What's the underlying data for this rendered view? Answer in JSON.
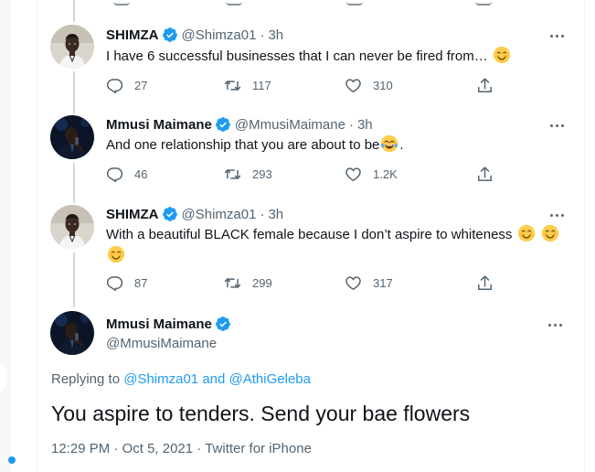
{
  "colors": {
    "accent": "#1d9bf0",
    "text_primary": "#0f1419",
    "text_secondary": "#536471",
    "thread_line": "#cfd9de"
  },
  "tweets": [
    {
      "name": "SHIMZA",
      "handle": "@Shimza01",
      "separator": "·",
      "time": "3h",
      "text": "I have 6 successful businesses that I can never be fired from…",
      "emoji_after": [
        "smiling-face-emoji"
      ],
      "replies": "27",
      "retweets": "117",
      "likes": "310",
      "avatar_icon": "shimza-avatar"
    },
    {
      "name": "Mmusi Maimane",
      "handle": "@MmusiMaimane",
      "separator": "·",
      "time": "3h",
      "text": "And one relationship that you are about to be",
      "emoji_after": [
        "tears-of-joy-emoji"
      ],
      "text_suffix": ".",
      "replies": "46",
      "retweets": "293",
      "likes": "1.2K",
      "avatar_icon": "maimane-avatar"
    },
    {
      "name": "SHIMZA",
      "handle": "@Shimza01",
      "separator": "·",
      "time": "3h",
      "text": "With a beautiful BLACK female because I don’t aspire to whiteness",
      "emoji_after": [
        "smiling-face-emoji",
        "smiling-face-emoji",
        "smiling-face-emoji"
      ],
      "replies": "87",
      "retweets": "299",
      "likes": "317",
      "avatar_icon": "shimza-avatar"
    }
  ],
  "main_tweet": {
    "name": "Mmusi Maimane",
    "handle": "@MmusiMaimane",
    "replying_prefix": "Replying to",
    "replying_user_1": "@Shimza01",
    "replying_and": "and",
    "replying_user_2": "@AthiGeleba",
    "text": "You aspire to tenders. Send your bae flowers",
    "time": "12:29 PM",
    "separator": "·",
    "date": "Oct 5, 2021",
    "source": "Twitter for iPhone"
  },
  "icons": {
    "verified": "verified-badge-icon",
    "more": "more-options-icon",
    "reply": "reply-icon",
    "retweet": "retweet-icon",
    "like": "heart-icon",
    "share": "share-icon"
  }
}
